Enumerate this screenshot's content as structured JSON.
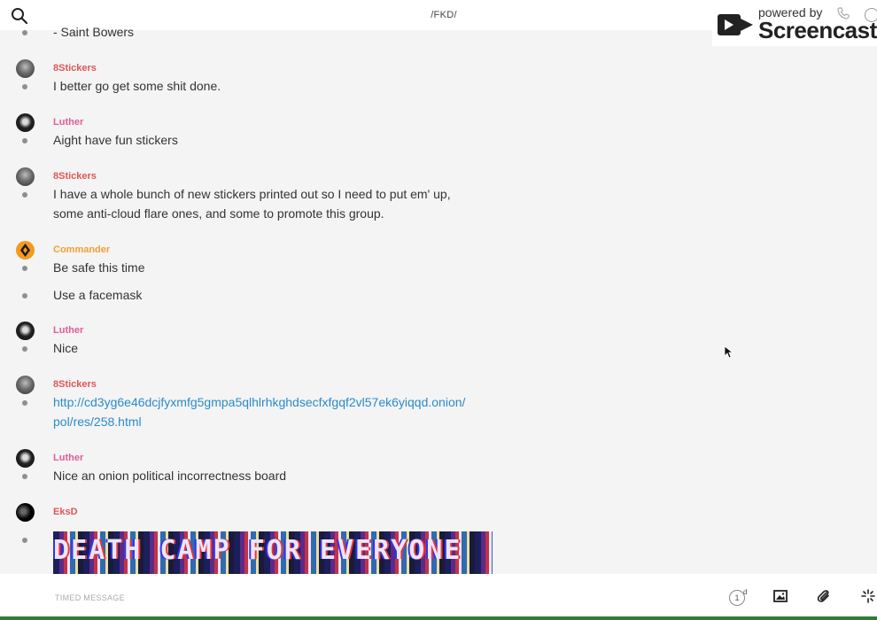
{
  "header": {
    "title": "/FKD/",
    "search_icon": "search-icon"
  },
  "watermark": {
    "powered_by": "powered by",
    "brand": "Screencastify",
    "logo_icon": "screencastify-logo-icon"
  },
  "messages": [
    {
      "text": "- Saint Bowers"
    },
    {
      "author": "8Stickers",
      "author_color": "#e25555",
      "text": "I better go get some shit done."
    },
    {
      "author": "Luther",
      "author_color": "#e05c9c",
      "text": "Aight have fun stickers"
    },
    {
      "author": "8Stickers",
      "author_color": "#e25555",
      "text_line1": "I have a whole bunch of new stickers printed out so I need to put em' up,",
      "text_line2": "some anti-cloud flare ones, and some to promote this group."
    },
    {
      "author": "Commander",
      "author_color": "#f0a030",
      "text": "Be safe this time"
    },
    {
      "text": "Use a facemask"
    },
    {
      "author": "Luther",
      "author_color": "#e05c9c",
      "text": "Nice"
    },
    {
      "author": "8Stickers",
      "author_color": "#e25555",
      "link_line1": "http://cd3yg6e46dcjfyxmfg5gmpa5qlhlrhkghdsecfxfgqf2vl57ek6yiqqd.onion/",
      "link_line2": "pol/res/258.html"
    },
    {
      "author": "Luther",
      "author_color": "#e05c9c",
      "text": "Nice an onion political incorrectness board"
    },
    {
      "author": "EksD",
      "author_color": "#e25555",
      "image_text": "DEATH CAMP FOR EVERYONE"
    }
  ],
  "composer": {
    "placeholder": "TIMED MESSAGE",
    "timer_value": "1",
    "timer_unit": "d",
    "icons": [
      "timer-icon",
      "image-icon",
      "paperclip-icon",
      "sparkle-icon"
    ]
  }
}
